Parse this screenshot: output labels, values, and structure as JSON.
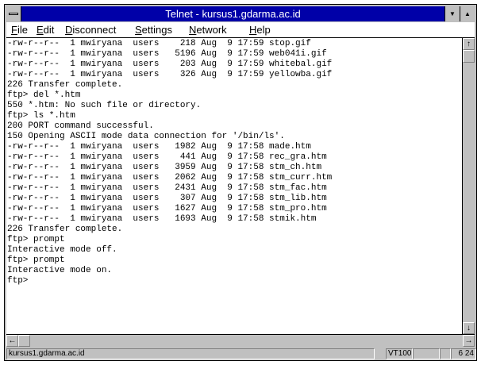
{
  "window": {
    "title": "Telnet - kursus1.gdarma.ac.id"
  },
  "icons": {
    "system_menu": "system-menu-icon",
    "minimize": "▼",
    "maximize": "▲",
    "scroll_up": "↑",
    "scroll_down": "↓",
    "scroll_left": "←",
    "scroll_right": "→"
  },
  "menu": {
    "items": [
      {
        "label": "File",
        "mnemonic": "F",
        "rest": "ile"
      },
      {
        "label": "Edit",
        "mnemonic": "E",
        "rest": "dit"
      },
      {
        "label": "Disconnect",
        "mnemonic": "D",
        "rest": "isconnect"
      },
      {
        "label": "Settings",
        "mnemonic": "S",
        "rest": "ettings"
      },
      {
        "label": "Network",
        "mnemonic": "N",
        "rest": "etwork"
      },
      {
        "label": "Help",
        "mnemonic": "H",
        "rest": "elp"
      }
    ]
  },
  "terminal": {
    "lines": [
      "-rw-r--r--  1 mwiryana  users    218 Aug  9 17:59 stop.gif",
      "-rw-r--r--  1 mwiryana  users   5196 Aug  9 17:59 web041i.gif",
      "-rw-r--r--  1 mwiryana  users    203 Aug  9 17:59 whitebal.gif",
      "-rw-r--r--  1 mwiryana  users    326 Aug  9 17:59 yellowba.gif",
      "226 Transfer complete.",
      "ftp> del *.htm",
      "550 *.htm: No such file or directory.",
      "ftp> ls *.htm",
      "200 PORT command successful.",
      "150 Opening ASCII mode data connection for '/bin/ls'.",
      "-rw-r--r--  1 mwiryana  users   1982 Aug  9 17:58 made.htm",
      "-rw-r--r--  1 mwiryana  users    441 Aug  9 17:58 rec_gra.htm",
      "-rw-r--r--  1 mwiryana  users   3959 Aug  9 17:58 stm_ch.htm",
      "-rw-r--r--  1 mwiryana  users   2062 Aug  9 17:58 stm_curr.htm",
      "-rw-r--r--  1 mwiryana  users   2431 Aug  9 17:58 stm_fac.htm",
      "-rw-r--r--  1 mwiryana  users    307 Aug  9 17:58 stm_lib.htm",
      "-rw-r--r--  1 mwiryana  users   1627 Aug  9 17:58 stm_pro.htm",
      "-rw-r--r--  1 mwiryana  users   1693 Aug  9 17:58 stmik.htm",
      "226 Transfer complete.",
      "ftp> prompt",
      "Interactive mode off.",
      "ftp> prompt",
      "Interactive mode on.",
      "ftp>"
    ]
  },
  "status": {
    "host": "kursus1.gdarma.ac.id",
    "terminal_type": "VT100",
    "field3": "",
    "field4": "",
    "cursor_pos": "6 24"
  },
  "colors": {
    "titlebar": "#0000a8",
    "chrome": "#c0c0c0",
    "terminal_bg": "#ffffff"
  }
}
